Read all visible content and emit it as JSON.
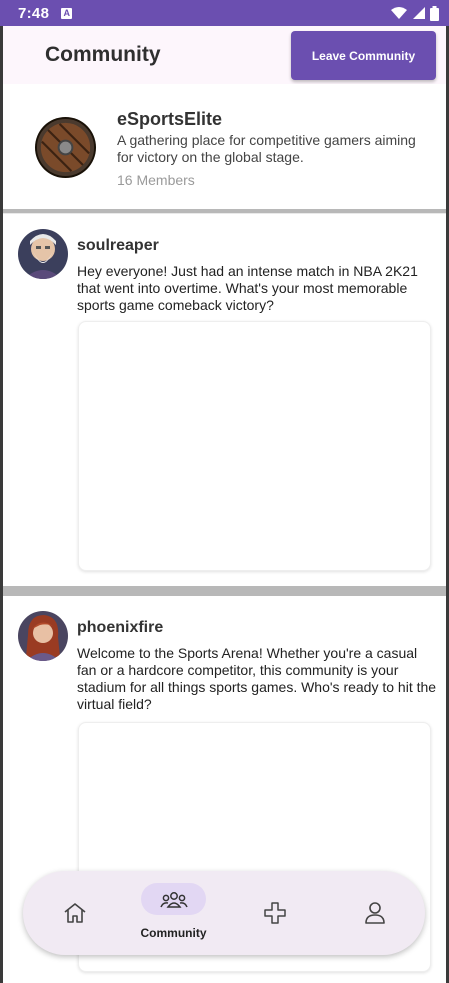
{
  "status_bar": {
    "time": "7:48",
    "left_icon": "a-notification-icon",
    "right_icons": [
      "wifi-icon",
      "signal-icon",
      "battery-icon"
    ]
  },
  "header": {
    "title": "Community",
    "leave_button_label": "Leave Community"
  },
  "community": {
    "name": "eSportsElite",
    "description": "A gathering place for competitive gamers aiming for victory on the global stage.",
    "members": "16 Members",
    "logo_icon": "wooden-shield-icon"
  },
  "posts": [
    {
      "username": "soulreaper",
      "text": "Hey everyone! Just had an intense match in NBA 2K21 that went into overtime. What's your most memorable sports game comeback victory?",
      "avatar": "old-man-avatar"
    },
    {
      "username": "phoenixfire",
      "text": "Welcome to the Sports Arena! Whether you're a casual fan or a hardcore competitor, this community is your stadium for all things sports games. Who's ready to hit the virtual field?",
      "avatar": "red-haired-woman-avatar"
    }
  ],
  "bottom_nav": {
    "items": [
      {
        "icon": "home-icon",
        "label": ""
      },
      {
        "icon": "community-icon",
        "label": "Community",
        "active": true
      },
      {
        "icon": "gamepad-icon",
        "label": ""
      },
      {
        "icon": "profile-icon",
        "label": ""
      }
    ]
  },
  "colors": {
    "primary": "#6b4fb0",
    "header_bg": "#fdf6fc",
    "nav_bg": "#f1eaf3",
    "active_pill": "#e2d7f3"
  }
}
